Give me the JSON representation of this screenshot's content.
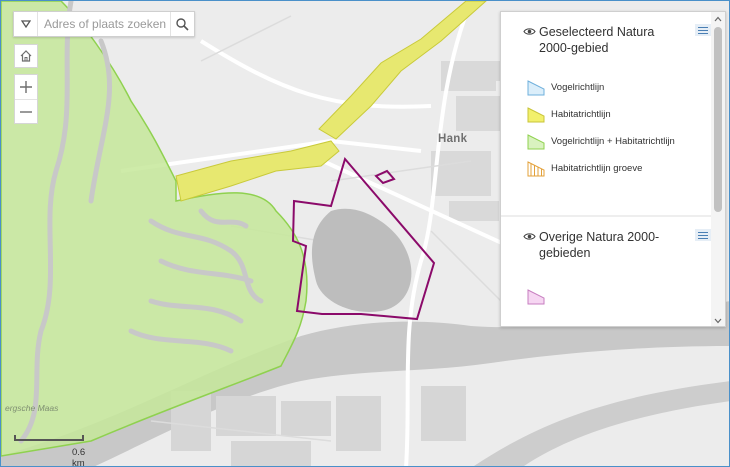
{
  "search": {
    "placeholder": "Adres of plaats zoeken",
    "dropdown_icon": "triangle-down-icon",
    "search_icon": "magnifier-icon"
  },
  "controls": {
    "home_icon": "home-icon",
    "zoom_in_icon": "plus-icon",
    "zoom_out_icon": "minus-icon"
  },
  "map": {
    "place_label": "Hank",
    "river_label": "ergsche Maas",
    "scale_label": "0.6 km",
    "colors": {
      "background": "#ececec",
      "water": "#c8c8c8",
      "habitat_fill": "#e7e870",
      "habitat_stroke": "#c9ca3a",
      "bird_habitat_fill": "#c5e89a",
      "bird_habitat_stroke": "#8fd14f",
      "selected_outline": "#8b0a6a"
    }
  },
  "legend": {
    "sections": [
      {
        "title": "Geselecteerd Natura 2000-gebied",
        "items": [
          {
            "label": "Vogelrichtlijn",
            "fill": "#dbeefa",
            "stroke": "#6fb0dc",
            "pattern": "solid"
          },
          {
            "label": "Habitatrichtlijn",
            "fill": "#f2f06c",
            "stroke": "#c8c43a",
            "pattern": "solid"
          },
          {
            "label": "Vogelrichtlijn + Habitatrichtlijn",
            "fill": "#d9f2bf",
            "stroke": "#8fd14f",
            "pattern": "solid"
          },
          {
            "label": "Habitatrichtlijn groeve",
            "fill": "#ffffff",
            "stroke": "#e3a13a",
            "pattern": "hatched"
          }
        ]
      },
      {
        "title": "Overige Natura 2000-gebieden",
        "items": [
          {
            "label": "",
            "fill": "#f6d6f2",
            "stroke": "#c77ec0",
            "pattern": "solid"
          }
        ]
      }
    ]
  }
}
